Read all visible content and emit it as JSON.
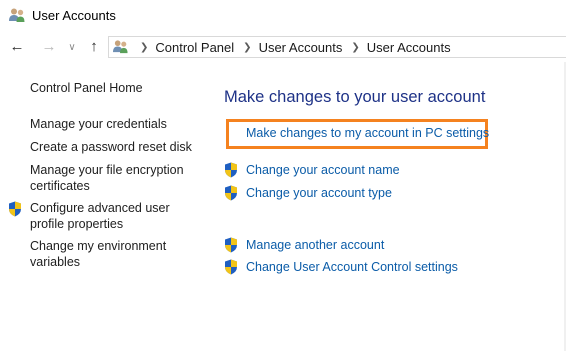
{
  "window": {
    "title": "User Accounts",
    "icon": "users-icon"
  },
  "nav": {
    "back_icon": "back-arrow-icon",
    "forward_icon": "forward-arrow-icon",
    "recent_icon": "chevron-down-icon",
    "up_icon": "up-arrow-icon"
  },
  "address": {
    "breadcrumbs": [
      "Control Panel",
      "User Accounts",
      "User Accounts"
    ]
  },
  "sidebar": {
    "home": "Control Panel Home",
    "links": [
      "Manage your credentials",
      "Create a password reset disk",
      "Manage your file encryption certificates",
      "Configure advanced user profile properties",
      "Change my environment variables"
    ]
  },
  "main": {
    "title": "Make changes to your user account",
    "pc_settings_link": "Make changes to my account in PC settings",
    "tasks": [
      "Change your account name",
      "Change your account type",
      "Manage another account",
      "Change User Account Control settings"
    ]
  },
  "colors": {
    "link": "#0b5ca8",
    "heading": "#1e3287",
    "highlight": "#f5821f"
  }
}
